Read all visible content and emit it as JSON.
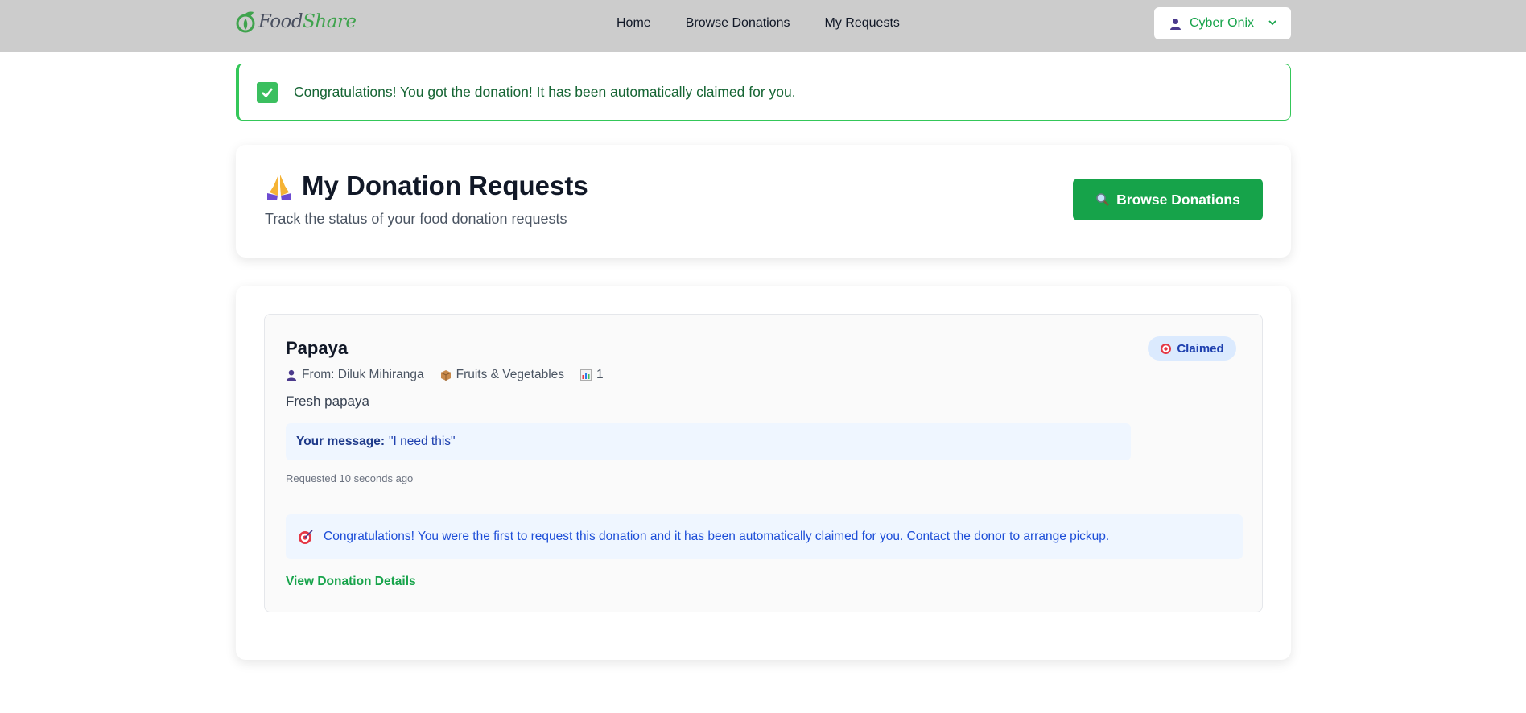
{
  "navbar": {
    "brand_food": "Food",
    "brand_share": "Share",
    "links": [
      "Home",
      "Browse Donations",
      "My Requests"
    ],
    "user_name": "Cyber Onix"
  },
  "alert": {
    "text": "Congratulations! You got the donation! It has been automatically claimed for you."
  },
  "header": {
    "title": "My Donation Requests",
    "subtitle": "Track the status of your food donation requests",
    "browse_button": "Browse Donations"
  },
  "request": {
    "title": "Papaya",
    "status": "Claimed",
    "from": "From: Diluk Mihiranga",
    "category": "Fruits & Vegetables",
    "quantity": "1",
    "description": "Fresh papaya",
    "message_label": "Your message:",
    "message": "\"I need this\"",
    "requested_time": "Requested 10 seconds ago",
    "info": "Congratulations! You were the first to request this donation and it has been automatically claimed for you. Contact the donor to arrange pickup.",
    "view_link": "View Donation Details"
  },
  "colors": {
    "accent_green": "#16a34a",
    "navbar_bg": "#cccccc",
    "badge_bg": "#dbeafe",
    "info_bg": "#eff6ff"
  }
}
